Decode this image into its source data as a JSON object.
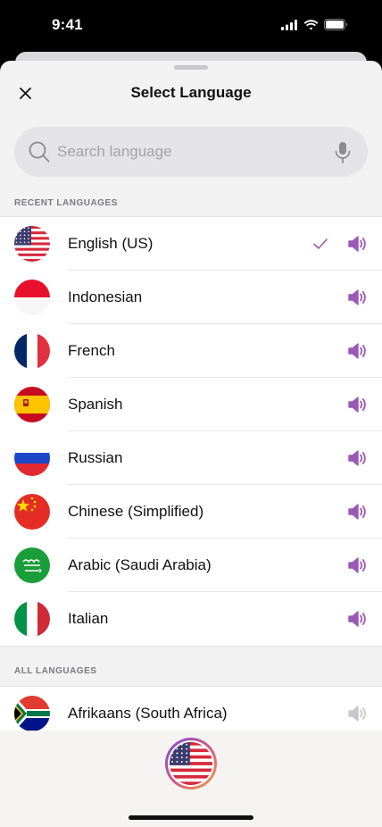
{
  "status": {
    "time": "9:41"
  },
  "header": {
    "title": "Select Language"
  },
  "search": {
    "placeholder": "Search language"
  },
  "sections": {
    "recent": "RECENT LANGUAGES",
    "all": "ALL LANGUAGES"
  },
  "colors": {
    "accent": "#9b59b6",
    "speaker_active": "#9b59b6",
    "speaker_inactive": "#c7c7cc"
  },
  "recent": [
    {
      "name": "English (US)",
      "flag": "us-flag",
      "selected": true
    },
    {
      "name": "Indonesian",
      "flag": "indonesia-flag",
      "selected": false
    },
    {
      "name": "French",
      "flag": "france-flag",
      "selected": false
    },
    {
      "name": "Spanish",
      "flag": "spain-flag",
      "selected": false
    },
    {
      "name": "Russian",
      "flag": "russia-flag",
      "selected": false
    },
    {
      "name": "Chinese (Simplified)",
      "flag": "china-flag",
      "selected": false
    },
    {
      "name": "Arabic (Saudi Arabia)",
      "flag": "saudi-arabia-flag",
      "selected": false
    },
    {
      "name": "Italian",
      "flag": "italy-flag",
      "selected": false
    }
  ],
  "all": [
    {
      "name": "Afrikaans (South Africa)",
      "flag": "south-africa-flag",
      "selected": false
    }
  ],
  "current": {
    "flag": "us-flag"
  }
}
